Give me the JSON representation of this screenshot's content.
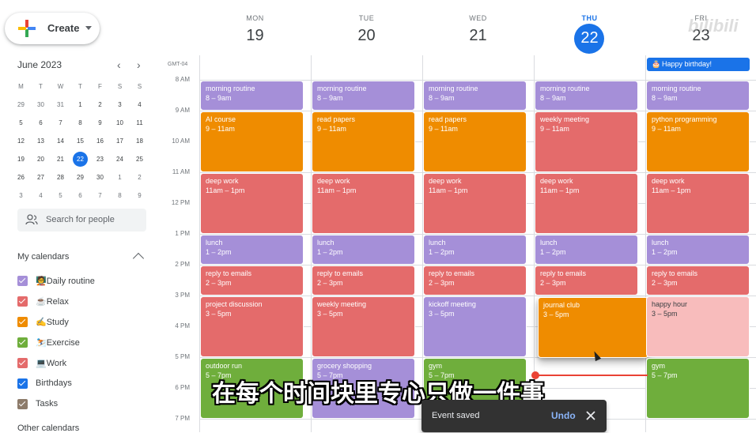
{
  "create": {
    "label": "Create"
  },
  "mini_calendar": {
    "month_label": "June 2023",
    "weekday_headers": [
      "M",
      "T",
      "W",
      "T",
      "F",
      "S",
      "S"
    ],
    "weeks": [
      [
        "29",
        "30",
        "31",
        "1",
        "2",
        "3",
        "4"
      ],
      [
        "5",
        "6",
        "7",
        "8",
        "9",
        "10",
        "11"
      ],
      [
        "12",
        "13",
        "14",
        "15",
        "16",
        "17",
        "18"
      ],
      [
        "19",
        "20",
        "21",
        "22",
        "23",
        "24",
        "25"
      ],
      [
        "26",
        "27",
        "28",
        "29",
        "30",
        "1",
        "2"
      ],
      [
        "3",
        "4",
        "5",
        "6",
        "7",
        "8",
        "9"
      ]
    ],
    "selected": "22"
  },
  "search_people": {
    "placeholder": "Search for people"
  },
  "my_calendars": {
    "title": "My calendars",
    "items": [
      {
        "label": "🧑‍🏫Daily routine",
        "color": "#a58fd8"
      },
      {
        "label": "☕Relax",
        "color": "#e46b6b"
      },
      {
        "label": "✍️Study",
        "color": "#ef8c00"
      },
      {
        "label": "⛷️Exercise",
        "color": "#6fae3c"
      },
      {
        "label": "💻Work",
        "color": "#e46b6b"
      },
      {
        "label": "Birthdays",
        "color": "#1a73e8"
      },
      {
        "label": "Tasks",
        "color": "#8d7b6a"
      }
    ]
  },
  "other_calendars": {
    "title": "Other calendars"
  },
  "timezone": "GMT-04",
  "days": [
    {
      "name": "MON",
      "num": "19"
    },
    {
      "name": "TUE",
      "num": "20"
    },
    {
      "name": "WED",
      "num": "21"
    },
    {
      "name": "THU",
      "num": "22",
      "today": true
    },
    {
      "name": "FRI",
      "num": "23"
    }
  ],
  "all_day": {
    "label": "Happy birthday!",
    "day": "FRI"
  },
  "hours": [
    "8 AM",
    "9 AM",
    "10 AM",
    "11 AM",
    "12 PM",
    "1 PM",
    "2 PM",
    "3 PM",
    "4 PM",
    "5 PM",
    "6 PM",
    "7 PM"
  ],
  "events": [
    {
      "day": 0,
      "title": "morning routine",
      "time": "8 – 9am",
      "color": "purple"
    },
    {
      "day": 0,
      "title": "AI course",
      "time": "9 – 11am",
      "color": "orange"
    },
    {
      "day": 0,
      "title": "deep work",
      "time": "11am – 1pm",
      "color": "red"
    },
    {
      "day": 0,
      "title": "lunch",
      "time": "1 – 2pm",
      "color": "purple"
    },
    {
      "day": 0,
      "title": "reply to emails",
      "time": "2 – 3pm",
      "color": "red"
    },
    {
      "day": 0,
      "title": "project discussion",
      "time": "3 – 5pm",
      "color": "red"
    },
    {
      "day": 0,
      "title": "outdoor run",
      "time": "5 – 7pm",
      "color": "green"
    },
    {
      "day": 1,
      "title": "morning routine",
      "time": "8 – 9am",
      "color": "purple"
    },
    {
      "day": 1,
      "title": "read papers",
      "time": "9 – 11am",
      "color": "orange"
    },
    {
      "day": 1,
      "title": "deep work",
      "time": "11am – 1pm",
      "color": "red"
    },
    {
      "day": 1,
      "title": "lunch",
      "time": "1 – 2pm",
      "color": "purple"
    },
    {
      "day": 1,
      "title": "reply to emails",
      "time": "2 – 3pm",
      "color": "red"
    },
    {
      "day": 1,
      "title": "weekly meeting",
      "time": "3 – 5pm",
      "color": "red"
    },
    {
      "day": 1,
      "title": "grocery shopping",
      "time": "5 – 7pm",
      "color": "purple"
    },
    {
      "day": 2,
      "title": "morning routine",
      "time": "8 – 9am",
      "color": "purple"
    },
    {
      "day": 2,
      "title": "read papers",
      "time": "9 – 11am",
      "color": "orange"
    },
    {
      "day": 2,
      "title": "deep work",
      "time": "11am – 1pm",
      "color": "red"
    },
    {
      "day": 2,
      "title": "lunch",
      "time": "1 – 2pm",
      "color": "purple"
    },
    {
      "day": 2,
      "title": "reply to emails",
      "time": "2 – 3pm",
      "color": "red"
    },
    {
      "day": 2,
      "title": "kickoff meeting",
      "time": "3 – 5pm",
      "color": "purple"
    },
    {
      "day": 2,
      "title": "gym",
      "time": "5 – 7pm",
      "color": "green"
    },
    {
      "day": 3,
      "title": "morning routine",
      "time": "8 – 9am",
      "color": "purple"
    },
    {
      "day": 3,
      "title": "weekly meeting",
      "time": "9 – 11am",
      "color": "red"
    },
    {
      "day": 3,
      "title": "deep work",
      "time": "11am – 1pm",
      "color": "red"
    },
    {
      "day": 3,
      "title": "lunch",
      "time": "1 – 2pm",
      "color": "purple"
    },
    {
      "day": 3,
      "title": "reply to emails",
      "time": "2 – 3pm",
      "color": "red"
    },
    {
      "day": 3,
      "title": "journal club",
      "time": "3 – 5pm",
      "color": "orange",
      "dragging": true
    },
    {
      "day": 4,
      "title": "morning routine",
      "time": "8 – 9am",
      "color": "purple"
    },
    {
      "day": 4,
      "title": "python programming",
      "time": "9 – 11am",
      "color": "orange"
    },
    {
      "day": 4,
      "title": "deep work",
      "time": "11am – 1pm",
      "color": "red"
    },
    {
      "day": 4,
      "title": "lunch",
      "time": "1 – 2pm",
      "color": "purple"
    },
    {
      "day": 4,
      "title": "reply to emails",
      "time": "2 – 3pm",
      "color": "red"
    },
    {
      "day": 4,
      "title": "happy hour",
      "time": "3 – 5pm",
      "color": "pink"
    },
    {
      "day": 4,
      "title": "gym",
      "time": "5 – 7pm",
      "color": "green"
    }
  ],
  "subtitle": "在每个时间块里专心只做一件事",
  "snackbar": {
    "text": "Event saved",
    "action": "Undo"
  },
  "watermark": "bilibili"
}
